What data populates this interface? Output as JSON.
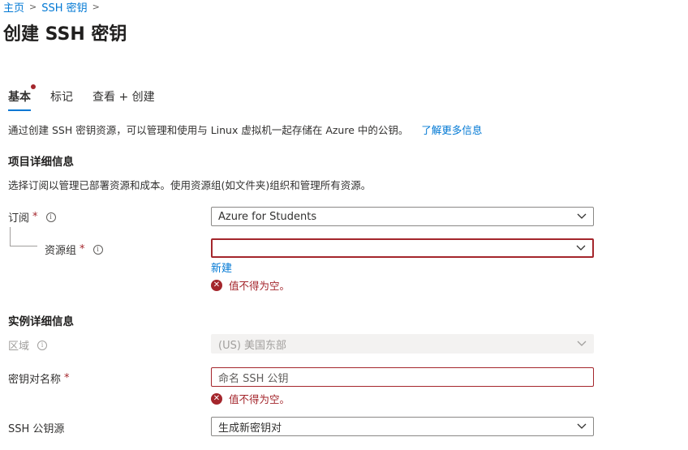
{
  "breadcrumb": {
    "home": "主页",
    "parent": "SSH 密钥"
  },
  "page": {
    "title": "创建 SSH 密钥"
  },
  "tabs": [
    {
      "label": "基本"
    },
    {
      "label": "标记"
    },
    {
      "label": "查看 + 创建"
    }
  ],
  "intro": {
    "text": "通过创建 SSH 密钥资源，可以管理和使用与 Linux 虚拟机一起存储在 Azure 中的公钥。",
    "learn_more": "了解更多信息"
  },
  "project": {
    "heading": "项目详细信息",
    "desc": "选择订阅以管理已部署资源和成本。使用资源组(如文件夹)组织和管理所有资源。",
    "subscription": {
      "label": "订阅",
      "value": "Azure for Students"
    },
    "resource_group": {
      "label": "资源组",
      "value": "",
      "new_link": "新建",
      "error": "值不得为空。"
    }
  },
  "instance": {
    "heading": "实例详细信息",
    "region": {
      "label": "区域",
      "value": "(US) 美国东部"
    },
    "key_pair_name": {
      "label": "密钥对名称",
      "placeholder": "命名 SSH 公钥",
      "error": "值不得为空。"
    },
    "ssh_source": {
      "label": "SSH 公钥源",
      "value": "生成新密钥对"
    }
  },
  "required_marker": "*",
  "colors": {
    "accent": "#0078d4",
    "error": "#a4262c"
  }
}
